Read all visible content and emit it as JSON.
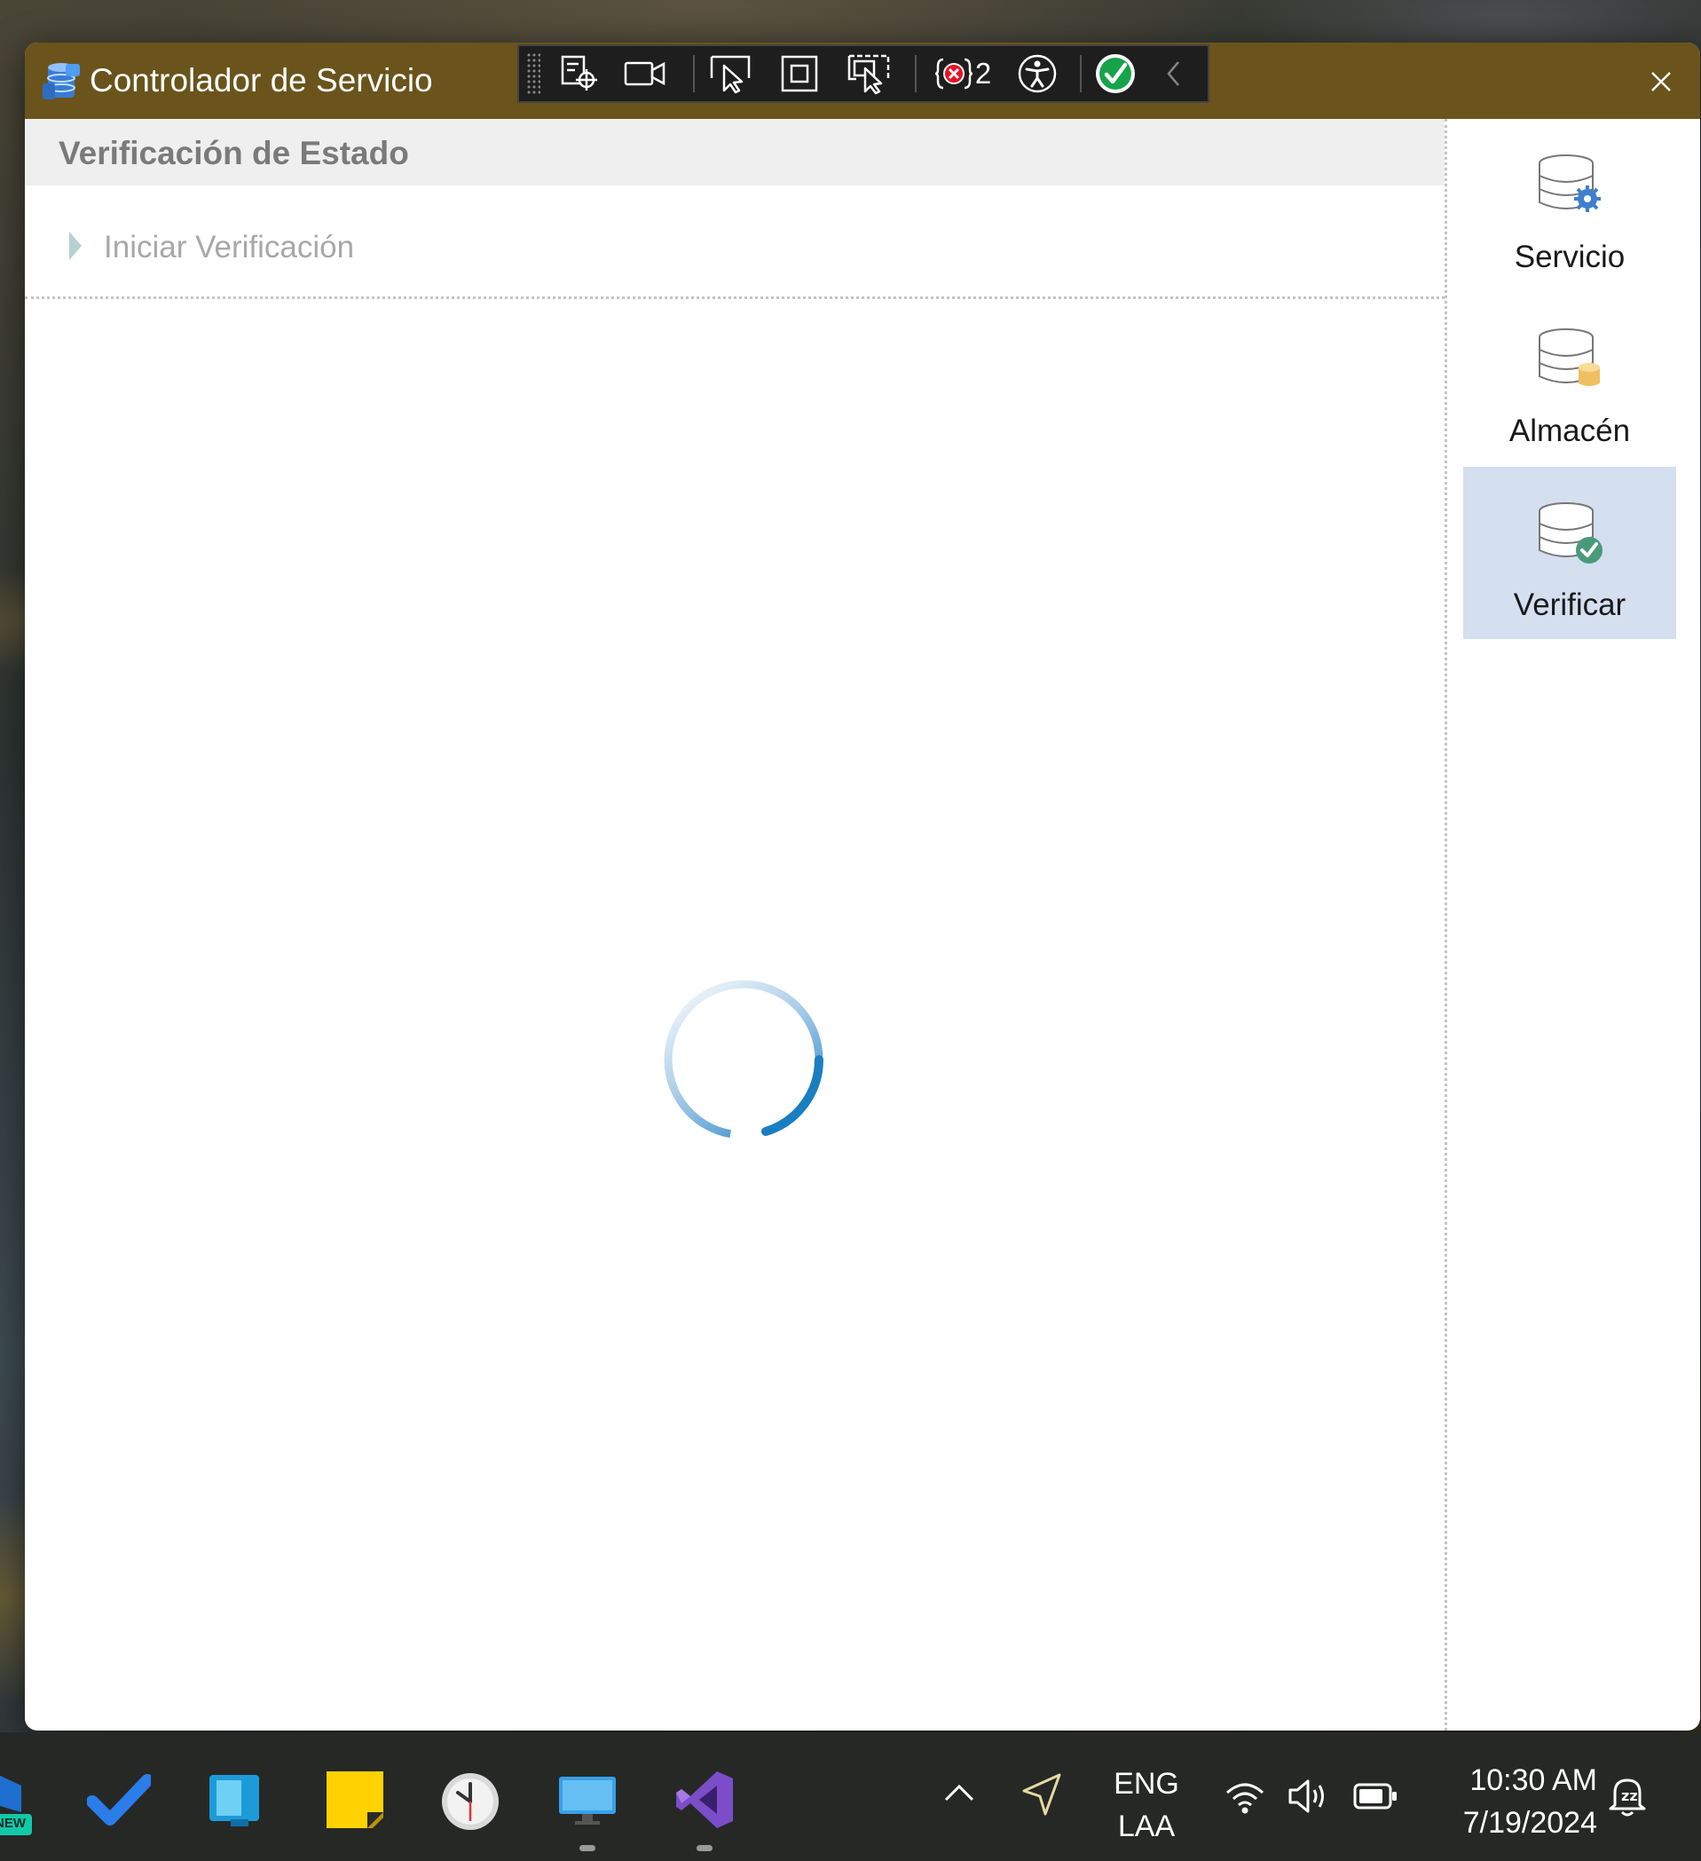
{
  "window": {
    "title": "Controlador de Servicio"
  },
  "devtools": {
    "error_count": "2"
  },
  "content": {
    "section_title": "Verificación de Estado",
    "expander_label": "Iniciar Verificación"
  },
  "nav": {
    "items": [
      {
        "label": "Servicio",
        "icon": "database-gear-icon",
        "selected": false
      },
      {
        "label": "Almacén",
        "icon": "database-storage-icon",
        "selected": false
      },
      {
        "label": "Verificar",
        "icon": "database-check-icon",
        "selected": true
      }
    ]
  },
  "taskbar": {
    "language_line1": "ENG",
    "language_line2": "LAA",
    "time": "10:30 AM",
    "date": "7/19/2024",
    "badge_new": "NEW"
  },
  "colors": {
    "titlebar": "#6a541c",
    "selected_nav": "#d4dff0",
    "spinner": "#1a7ec2"
  }
}
